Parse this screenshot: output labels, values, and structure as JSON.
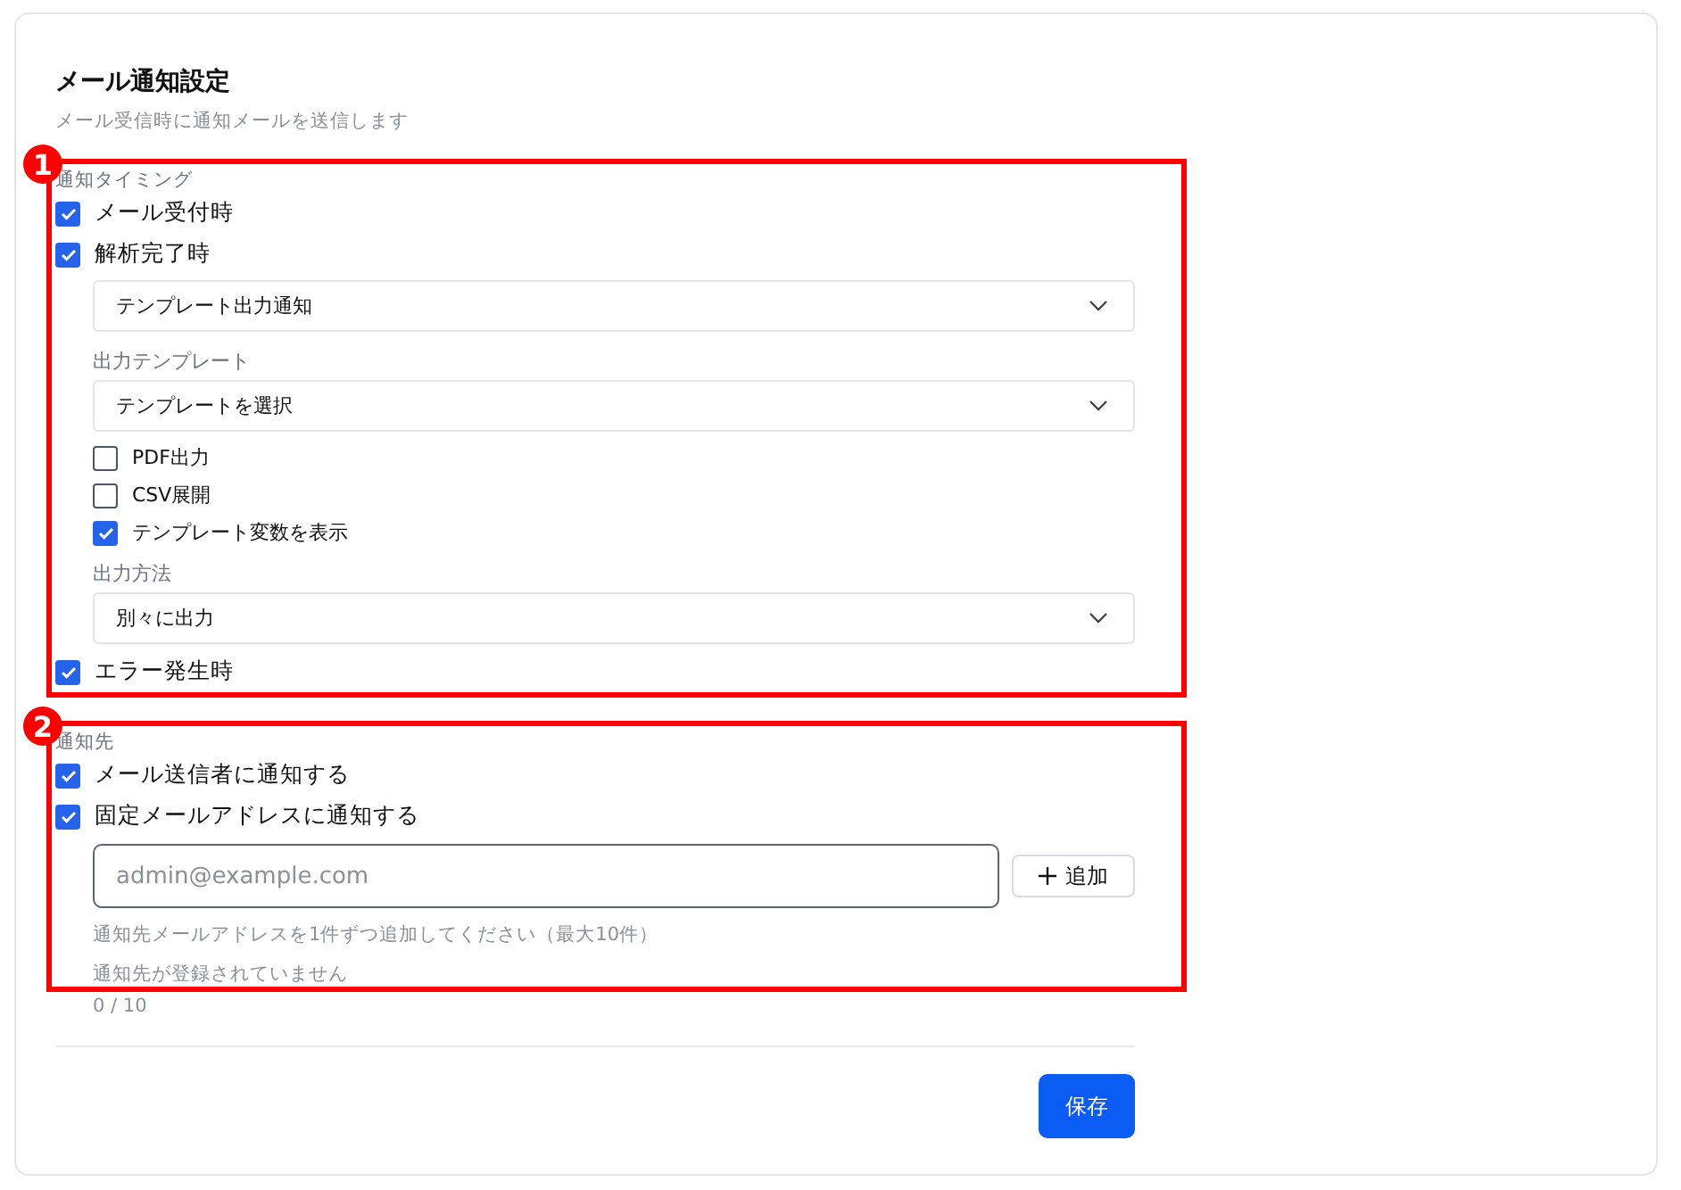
{
  "title": "メール通知設定",
  "subtitle": "メール受信時に通知メールを送信します",
  "sections": [
    {
      "label": "通知タイミング",
      "annotation": "1",
      "items": [
        {
          "kind": "check",
          "label": "メール受付時",
          "checked": true
        },
        {
          "kind": "check",
          "label": "解析完了時",
          "checked": true
        },
        {
          "kind": "select",
          "value": "テンプレート出力通知"
        },
        {
          "kind": "label",
          "label": "出力テンプレート"
        },
        {
          "kind": "select",
          "value": "テンプレートを選択"
        },
        {
          "kind": "subcheck",
          "label": "PDF出力",
          "checked": false
        },
        {
          "kind": "subcheck",
          "label": "CSV展開",
          "checked": false
        },
        {
          "kind": "subcheck",
          "label": "テンプレート変数を表示",
          "checked": true
        },
        {
          "kind": "label",
          "label": "出力方法"
        },
        {
          "kind": "select",
          "value": "別々に出力"
        },
        {
          "kind": "check",
          "label": "エラー発生時",
          "checked": true
        }
      ]
    },
    {
      "label": "通知先",
      "annotation": "2",
      "items": [
        {
          "kind": "check",
          "label": "メール送信者に通知する",
          "checked": true
        },
        {
          "kind": "check",
          "label": "固定メールアドレスに通知する",
          "checked": true
        },
        {
          "kind": "email",
          "placeholder": "admin@example.com",
          "button": "追加"
        },
        {
          "kind": "help",
          "label": "通知先メールアドレスを1件ずつ追加してください（最大10件）"
        },
        {
          "kind": "help",
          "label": "通知先が登録されていません"
        }
      ]
    }
  ],
  "count": "0 / 10",
  "save": "保存"
}
